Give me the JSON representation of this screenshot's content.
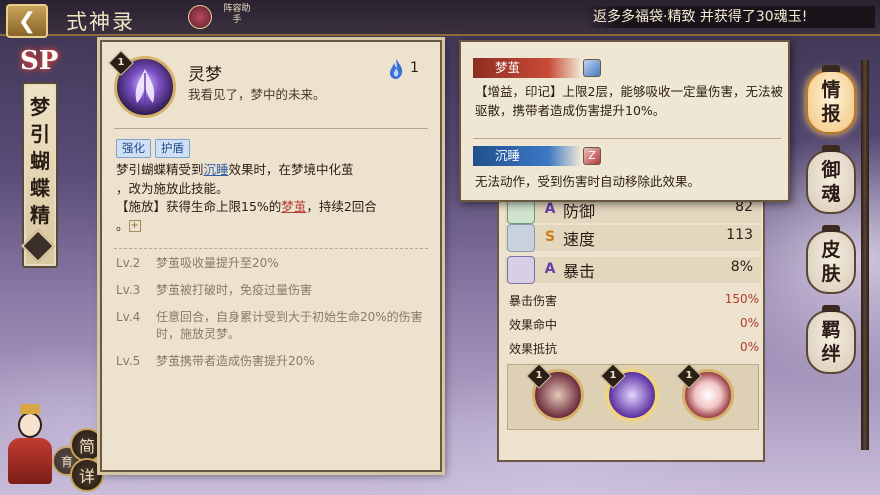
{
  "header": {
    "title": "式神录",
    "helper_label": "阵容助手",
    "marquee": "返多多福袋·精致 并获得了30魂玉!"
  },
  "shikigami": {
    "rarity": "SP",
    "name": "梦引蝴蝶精"
  },
  "bottom_buttons": {
    "simple": "简",
    "detail": "详",
    "partial_left": "育",
    "partial_left2": "成"
  },
  "skill": {
    "level": "1",
    "name": "灵梦",
    "quote": "我看见了，梦中的未来。",
    "cost": "1",
    "tags": [
      "强化",
      "护盾"
    ],
    "desc_line1_pre": "梦引蝴蝶精受到",
    "desc_line1_kw": "沉睡",
    "desc_line1_post": "效果时，在梦境中化茧",
    "desc_line2": "，改为施放此技能。",
    "desc_line3_pre": "【施放】获得生命上限15%的",
    "desc_line3_kw": "梦茧",
    "desc_line3_post": "，持续2回合",
    "desc_line4": "。",
    "levels": [
      {
        "key": "Lv.2",
        "text": "梦茧吸收量提升至20%"
      },
      {
        "key": "Lv.3",
        "text": "梦茧被打破时，免疫过量伤害"
      },
      {
        "key": "Lv.4",
        "text": "任意回合，自身累计受到大于初始生命20%的伤害时，施放灵梦。"
      },
      {
        "key": "Lv.5",
        "text": "梦茧携带者造成伤害提升20%"
      }
    ]
  },
  "tooltip": {
    "effect1_name": "梦茧",
    "effect1_text": "【增益，印记】上限2层，能够吸收一定量伤害，无法被驱散，携带者造成伤害提升10%。",
    "effect2_name": "沉睡",
    "effect2_text": "无法动作，受到伤害时自动移除此效果。"
  },
  "stats": {
    "rows": [
      {
        "label": "防御",
        "value": "82"
      },
      {
        "label": "速度",
        "value": "113"
      },
      {
        "label": "暴击",
        "value": "8%"
      }
    ],
    "sub_rows": [
      {
        "label": "暴击伤害",
        "value": "150%"
      },
      {
        "label": "效果命中",
        "value": "0%"
      },
      {
        "label": "效果抵抗",
        "value": "0%"
      }
    ],
    "skill_levels": [
      "1",
      "1",
      "1"
    ]
  },
  "side_menu": [
    {
      "label": "情报",
      "active": true
    },
    {
      "label": "御魂",
      "active": false
    },
    {
      "label": "皮肤",
      "active": false
    },
    {
      "label": "羁绊",
      "active": false
    }
  ],
  "colors": {
    "keyword_blue": "#2f5ea6",
    "keyword_red": "#b23a2e",
    "panel_bg": "#ece2cd",
    "gold_border": "#d5b26a"
  }
}
